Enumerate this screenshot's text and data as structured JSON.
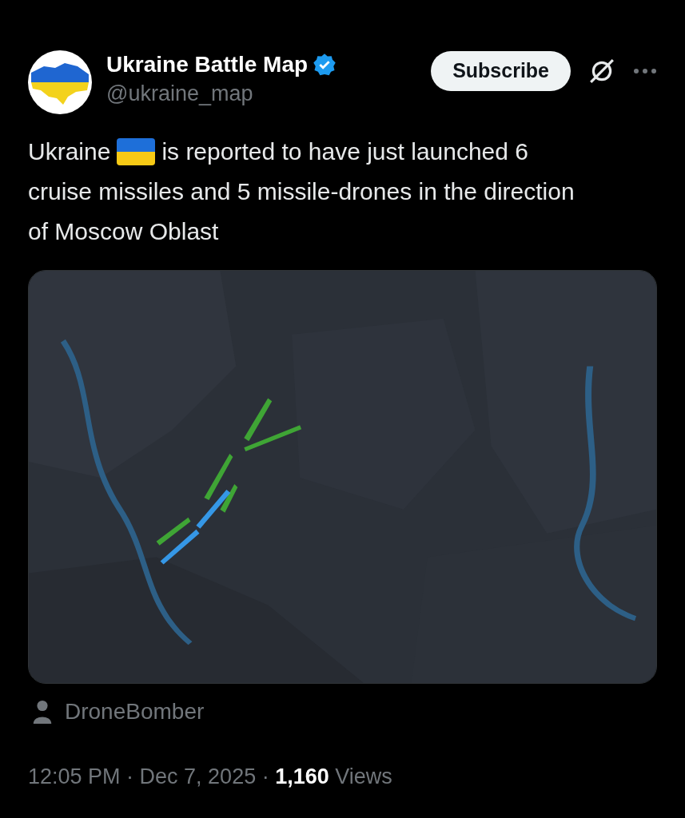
{
  "author": {
    "name": "Ukraine Battle Map",
    "verified": true,
    "handle": "@ukraine_map"
  },
  "subscribe_button": "Subscribe",
  "post": {
    "text_before_flag": "Ukraine",
    "text_after_flag": "is reported to have just launched 6",
    "text_continued": "cruise missiles and 5 missile-drones in the direction of Moscow Oblast"
  },
  "attribution": "DroneBomber",
  "meta": "12:05 PM · Dec 7, 2025 · **1,160** Views"
}
